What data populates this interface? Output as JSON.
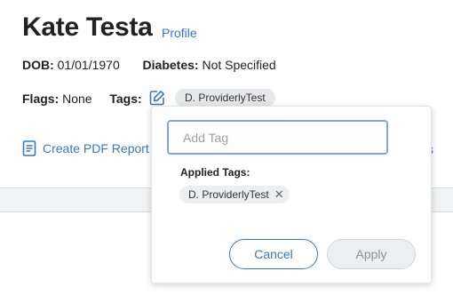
{
  "patient": {
    "name": "Kate Testa",
    "profile_link": "Profile"
  },
  "info": {
    "dob_label": "DOB:",
    "dob_value": "01/01/1970",
    "diabetes_label": "Diabetes:",
    "diabetes_value": "Not Specified",
    "flags_label": "Flags:",
    "flags_value": "None",
    "tags_label": "Tags:",
    "tags": [
      "D. ProviderlyTest"
    ]
  },
  "actions": {
    "create_pdf": "Create PDF Report",
    "partial_right_link": "s"
  },
  "tag_popover": {
    "input_placeholder": "Add Tag",
    "input_value": "",
    "applied_label": "Applied Tags:",
    "applied_tags": [
      "D. ProviderlyTest"
    ],
    "remove_glyph": "✕",
    "cancel_label": "Cancel",
    "apply_label": "Apply"
  },
  "colors": {
    "accent": "#3578c9",
    "focus_border": "#7fa7dc",
    "chip_bg": "#e6e8ec",
    "disabled_bg": "#eceef1"
  },
  "icons": {
    "edit": "edit-tags-icon",
    "document": "document-icon",
    "remove": "remove-tag-icon"
  }
}
